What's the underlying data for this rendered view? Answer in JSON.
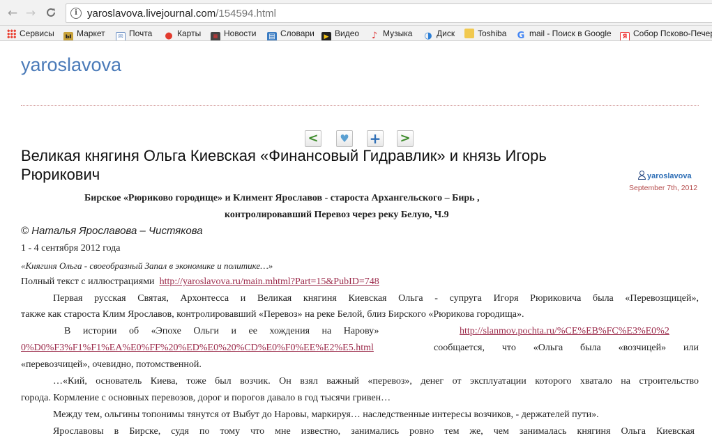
{
  "browser": {
    "nav": {
      "back": "←",
      "forward": "→",
      "reload": "C"
    },
    "url_host": "yaroslavova.livejournal.com",
    "url_path": "/154594.html",
    "bookmarks": [
      {
        "label": "Сервисы",
        "icon": "apps-grid-icon"
      },
      {
        "label": "Маркет",
        "icon": "market-icon"
      },
      {
        "label": "Почта",
        "icon": "mail-icon"
      },
      {
        "label": "Карты",
        "icon": "maps-pin-icon"
      },
      {
        "label": "Новости",
        "icon": "news-icon"
      },
      {
        "label": "Словари",
        "icon": "dictionary-icon"
      },
      {
        "label": "Видео",
        "icon": "video-icon"
      },
      {
        "label": "Музыка",
        "icon": "music-icon"
      },
      {
        "label": "Диск",
        "icon": "disk-icon"
      },
      {
        "label": "Toshiba",
        "icon": "folder-icon"
      },
      {
        "label": "mail - Поиск в Google",
        "icon": "google-icon"
      },
      {
        "label": "Собор Псково-Печер",
        "icon": "yandex-icon"
      }
    ]
  },
  "page": {
    "blog_title": "yaroslavova",
    "entry_title": "Великая княгиня Ольга Киевская «Финансовый Гидравлик» и князь Игорь Рюрикович",
    "author": "yaroslavova",
    "date": "September 7th, 2012",
    "entry_nav": {
      "prev": "<",
      "memories": "♥",
      "track": "+",
      "next": ">"
    },
    "subtitle_line1": "Бирское «Рюриково городище» и Климент Ярославов - староста Архангельского – Бирь ,",
    "subtitle_line2": "контролировавший Перевоз через реку Белую, Ч.9",
    "copyright": "© Наталья Ярославова – Чистякова",
    "dates_line": "1 - 4 сентября 2012 года",
    "quote_line": "«Княгиня Ольга - своеобразный Запал в экономике и политике…»",
    "fulltext_label": "Полный текст с иллюстрациями",
    "fulltext_link": "http://yaroslavova.ru/main.mhtml?Part=15&PubID=748",
    "p1_line1": "Первая русская Святая, Архонтесса и Великая княгиня Киевская Ольга - супруга Игоря Рюриковича была «Перевозщицей»,",
    "p1_line2": "также как староста Клим Ярославов, контролировавший «Перевоз» на реке Белой, близ Бирского «Рюрикова городища».",
    "p2_start": "В истории об «Эпохе Ольги и ее хождения на Нарову»",
    "p2_link_part1": "http://slanmov.pochta.ru/%CE%EB%FC%E3%E0%2",
    "p2_link_part2": "0%D0%F3%F1%F1%EA%E0%FF%20%ED%E0%20%CD%E0%F0%EE%E2%E5.html",
    "p2_after": "сообщается, что «Ольга была «возчицей» или",
    "p2_line3": "«перевозчицей», очевидно, потомственной.",
    "p3_line1": "…«Кий, основатель Киева, тоже был возчик. Он взял важный «перевоз», денег от эксплуатации которого хватало на строительство",
    "p3_line2": "города. Кормление с основных перевозов, дорог и порогов давало в год тысячи гривен…",
    "p4_line1": "Между тем, ольгины топонимы тянутся от Выбут до Наровы, маркируя… наследственные интересы возчиков, - держателей пути».",
    "p5_line1": "Ярославовы в Бирске, судя по тому что мне известно, занимались ровно тем же, чем занималась княгиня Ольга Киевская"
  }
}
